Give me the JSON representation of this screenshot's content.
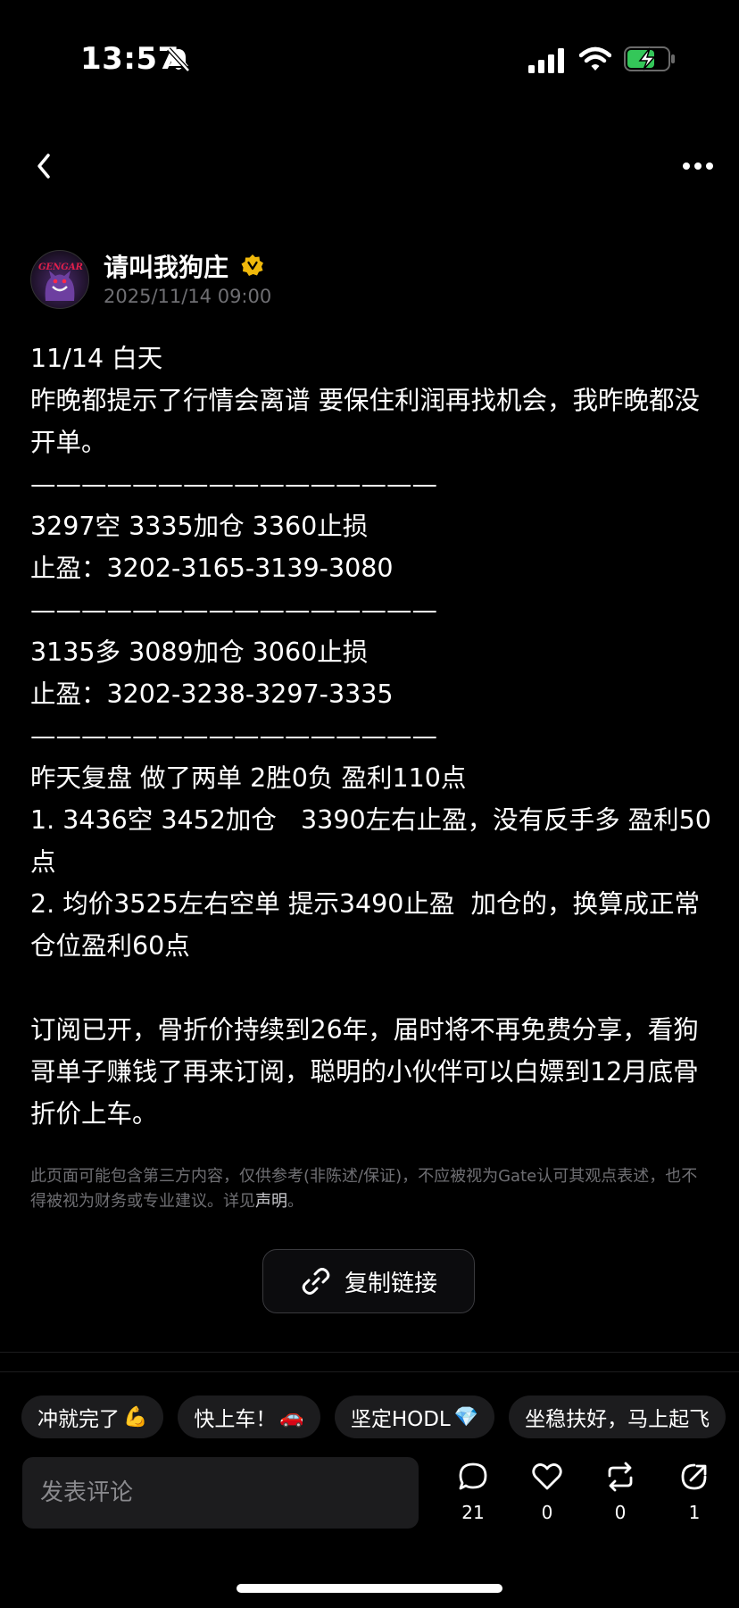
{
  "status_bar": {
    "time": "13:57"
  },
  "post": {
    "author": "请叫我狗庄",
    "avatar_text": "GENGAR",
    "date": "2025/11/14 09:00",
    "lines": [
      "11/14 白天",
      "昨晚都提示了行情会离谱 要保住利润再找机会，我昨晚都没开单。",
      "————————————————",
      "3297空 3335加仓 3360止损",
      "止盈：3202-3165-3139-3080",
      "————————————————",
      "3135多 3089加仓 3060止损",
      "止盈：3202-3238-3297-3335",
      "————————————————",
      "昨天复盘 做了两单 2胜0负 盈利110点",
      "1. 3436空 3452加仓   3390左右止盈，没有反手多 盈利50点",
      "2. 均价3525左右空单 提示3490止盈  加仓的，换算成正常仓位盈利60点",
      "",
      "订阅已开，骨折价持续到26年，届时将不再免费分享，看狗哥单子赚钱了再来订阅，聪明的小伙伴可以白嫖到12月底骨折价上车。"
    ],
    "disclaimer": "此页面可能包含第三方内容，仅供参考(非陈述/保证)，不应被视为Gate认可其观点表述，也不得被视为财务或专业建议。详见",
    "disclaimer_link": "声明",
    "disclaimer_end": "。",
    "copy_link_label": "复制链接"
  },
  "quick_replies": [
    {
      "text": "冲就完了",
      "emoji": "💪"
    },
    {
      "text": "快上车！",
      "emoji": "🚗"
    },
    {
      "text": "坚定HODL",
      "emoji": "💎"
    },
    {
      "text": "坐稳扶好，马上起飞",
      "emoji": ""
    }
  ],
  "bottom_bar": {
    "comment_placeholder": "发表评论",
    "comments": "21",
    "likes": "0",
    "reposts": "0",
    "shares": "1"
  },
  "icons": {
    "bell": "bell-slash-icon",
    "signal": "cellular-signal-icon",
    "wifi": "wifi-icon",
    "battery": "battery-charging-icon",
    "back": "chevron-left-icon",
    "more": "more-dots-icon",
    "verified": "verified-badge-icon",
    "link": "link-icon",
    "comment": "comment-bubble-icon",
    "like": "heart-icon",
    "repost": "repost-icon",
    "share": "share-icon"
  },
  "colors": {
    "background": "#000000",
    "muted_text": "#6f6f73",
    "chip_bg": "#1c1c1e",
    "badge": "#f0b90b",
    "battery_green": "#34c759"
  }
}
